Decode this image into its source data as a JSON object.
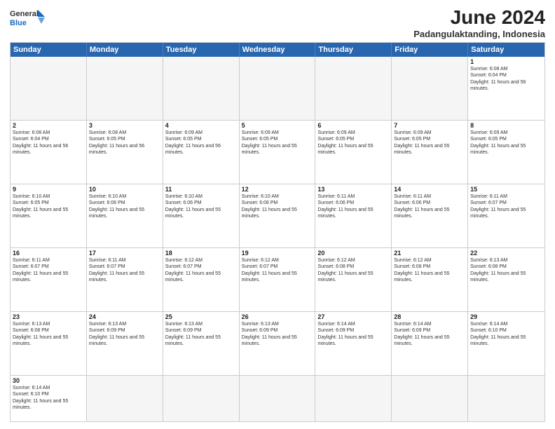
{
  "header": {
    "logo_line1": "General",
    "logo_line2": "Blue",
    "month_title": "June 2024",
    "location": "Padangulaktanding, Indonesia"
  },
  "day_headers": [
    "Sunday",
    "Monday",
    "Tuesday",
    "Wednesday",
    "Thursday",
    "Friday",
    "Saturday"
  ],
  "weeks": [
    [
      {
        "day": "",
        "empty": true
      },
      {
        "day": "",
        "empty": true
      },
      {
        "day": "",
        "empty": true
      },
      {
        "day": "",
        "empty": true
      },
      {
        "day": "",
        "empty": true
      },
      {
        "day": "",
        "empty": true
      },
      {
        "day": "1",
        "sunrise": "6:08 AM",
        "sunset": "6:04 PM",
        "daylight": "11 hours and 56 minutes."
      }
    ],
    [
      {
        "day": "2",
        "sunrise": "6:08 AM",
        "sunset": "6:04 PM",
        "daylight": "11 hours and 56 minutes."
      },
      {
        "day": "3",
        "sunrise": "6:08 AM",
        "sunset": "6:05 PM",
        "daylight": "11 hours and 56 minutes."
      },
      {
        "day": "4",
        "sunrise": "6:09 AM",
        "sunset": "6:05 PM",
        "daylight": "11 hours and 56 minutes."
      },
      {
        "day": "5",
        "sunrise": "6:09 AM",
        "sunset": "6:05 PM",
        "daylight": "11 hours and 55 minutes."
      },
      {
        "day": "6",
        "sunrise": "6:09 AM",
        "sunset": "6:05 PM",
        "daylight": "11 hours and 55 minutes."
      },
      {
        "day": "7",
        "sunrise": "6:09 AM",
        "sunset": "6:05 PM",
        "daylight": "11 hours and 55 minutes."
      },
      {
        "day": "8",
        "sunrise": "6:09 AM",
        "sunset": "6:05 PM",
        "daylight": "11 hours and 55 minutes."
      }
    ],
    [
      {
        "day": "9",
        "sunrise": "6:10 AM",
        "sunset": "6:05 PM",
        "daylight": "11 hours and 55 minutes."
      },
      {
        "day": "10",
        "sunrise": "6:10 AM",
        "sunset": "6:06 PM",
        "daylight": "11 hours and 55 minutes."
      },
      {
        "day": "11",
        "sunrise": "6:10 AM",
        "sunset": "6:06 PM",
        "daylight": "11 hours and 55 minutes."
      },
      {
        "day": "12",
        "sunrise": "6:10 AM",
        "sunset": "6:06 PM",
        "daylight": "11 hours and 55 minutes."
      },
      {
        "day": "13",
        "sunrise": "6:11 AM",
        "sunset": "6:06 PM",
        "daylight": "11 hours and 55 minutes."
      },
      {
        "day": "14",
        "sunrise": "6:11 AM",
        "sunset": "6:06 PM",
        "daylight": "11 hours and 55 minutes."
      },
      {
        "day": "15",
        "sunrise": "6:11 AM",
        "sunset": "6:07 PM",
        "daylight": "11 hours and 55 minutes."
      }
    ],
    [
      {
        "day": "16",
        "sunrise": "6:11 AM",
        "sunset": "6:07 PM",
        "daylight": "11 hours and 55 minutes."
      },
      {
        "day": "17",
        "sunrise": "6:11 AM",
        "sunset": "6:07 PM",
        "daylight": "11 hours and 55 minutes."
      },
      {
        "day": "18",
        "sunrise": "6:12 AM",
        "sunset": "6:07 PM",
        "daylight": "11 hours and 55 minutes."
      },
      {
        "day": "19",
        "sunrise": "6:12 AM",
        "sunset": "6:07 PM",
        "daylight": "11 hours and 55 minutes."
      },
      {
        "day": "20",
        "sunrise": "6:12 AM",
        "sunset": "6:08 PM",
        "daylight": "11 hours and 55 minutes."
      },
      {
        "day": "21",
        "sunrise": "6:12 AM",
        "sunset": "6:08 PM",
        "daylight": "11 hours and 55 minutes."
      },
      {
        "day": "22",
        "sunrise": "6:13 AM",
        "sunset": "6:08 PM",
        "daylight": "11 hours and 55 minutes."
      }
    ],
    [
      {
        "day": "23",
        "sunrise": "6:13 AM",
        "sunset": "6:08 PM",
        "daylight": "11 hours and 55 minutes."
      },
      {
        "day": "24",
        "sunrise": "6:13 AM",
        "sunset": "6:09 PM",
        "daylight": "11 hours and 55 minutes."
      },
      {
        "day": "25",
        "sunrise": "6:13 AM",
        "sunset": "6:09 PM",
        "daylight": "11 hours and 55 minutes."
      },
      {
        "day": "26",
        "sunrise": "6:13 AM",
        "sunset": "6:09 PM",
        "daylight": "11 hours and 55 minutes."
      },
      {
        "day": "27",
        "sunrise": "6:14 AM",
        "sunset": "6:09 PM",
        "daylight": "11 hours and 55 minutes."
      },
      {
        "day": "28",
        "sunrise": "6:14 AM",
        "sunset": "6:09 PM",
        "daylight": "11 hours and 55 minutes."
      },
      {
        "day": "29",
        "sunrise": "6:14 AM",
        "sunset": "6:10 PM",
        "daylight": "11 hours and 55 minutes."
      }
    ],
    [
      {
        "day": "30",
        "sunrise": "6:14 AM",
        "sunset": "6:10 PM",
        "daylight": "11 hours and 55 minutes."
      },
      {
        "day": "",
        "empty": true
      },
      {
        "day": "",
        "empty": true
      },
      {
        "day": "",
        "empty": true
      },
      {
        "day": "",
        "empty": true
      },
      {
        "day": "",
        "empty": true
      },
      {
        "day": "",
        "empty": true
      }
    ]
  ],
  "labels": {
    "sunrise": "Sunrise:",
    "sunset": "Sunset:",
    "daylight": "Daylight:"
  }
}
